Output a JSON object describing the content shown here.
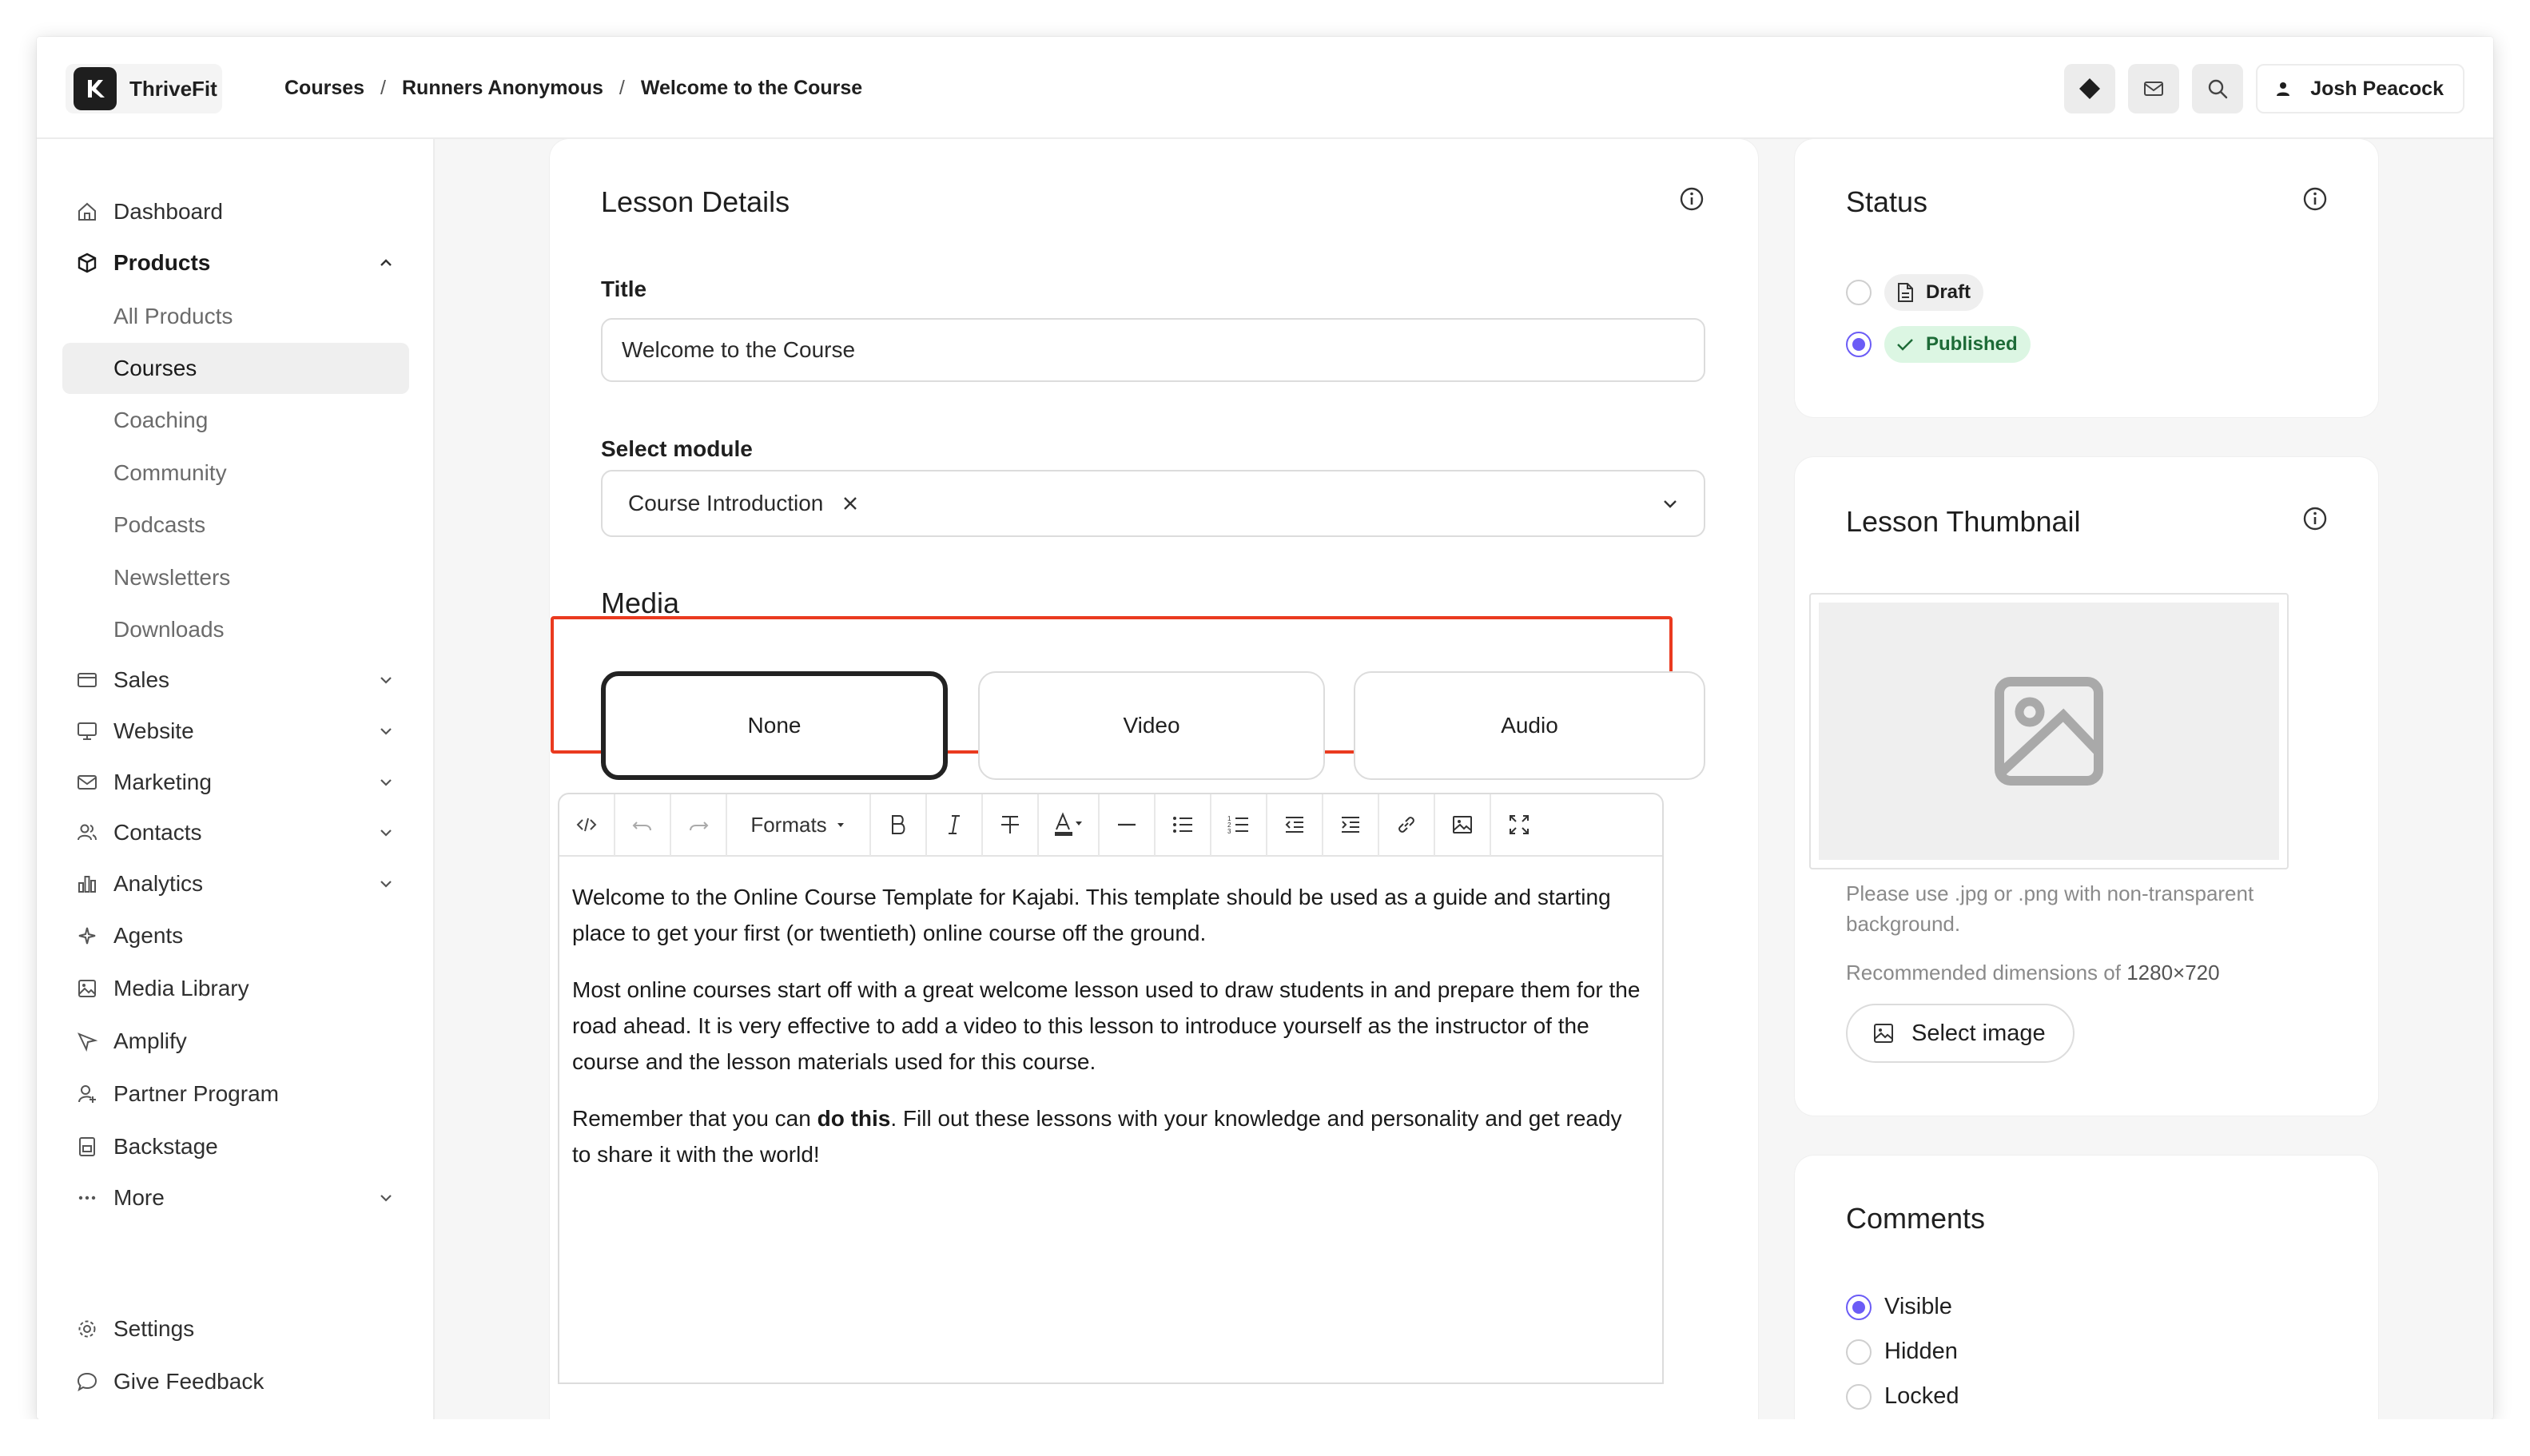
{
  "app": {
    "name": "ThriveFit"
  },
  "breadcrumb": [
    "Courses",
    "Runners Anonymous",
    "Welcome to the Course"
  ],
  "user": {
    "name": "Josh Peacock"
  },
  "sidebar": {
    "items": [
      {
        "label": "Dashboard",
        "icon": "home-icon"
      },
      {
        "label": "Products",
        "icon": "box-icon"
      },
      {
        "label": "Sales",
        "icon": "credit-card-icon"
      },
      {
        "label": "Website",
        "icon": "monitor-icon"
      },
      {
        "label": "Marketing",
        "icon": "mail-icon"
      },
      {
        "label": "Contacts",
        "icon": "users-icon"
      },
      {
        "label": "Analytics",
        "icon": "bar-chart-icon"
      },
      {
        "label": "Agents",
        "icon": "sparkle-icon"
      },
      {
        "label": "Media Library",
        "icon": "image-icon"
      },
      {
        "label": "Amplify",
        "icon": "send-icon"
      },
      {
        "label": "Partner Program",
        "icon": "partner-icon"
      },
      {
        "label": "Backstage",
        "icon": "backstage-icon"
      },
      {
        "label": "More",
        "icon": "more-icon"
      }
    ],
    "products_sub": [
      "All Products",
      "Courses",
      "Coaching",
      "Community",
      "Podcasts",
      "Newsletters",
      "Downloads"
    ],
    "footer": [
      {
        "label": "Settings",
        "icon": "gear-icon"
      },
      {
        "label": "Give Feedback",
        "icon": "chat-icon"
      }
    ]
  },
  "lesson": {
    "heading": "Lesson Details",
    "title_label": "Title",
    "title_value": "Welcome to the Course",
    "module_label": "Select module",
    "module_value": "Course Introduction",
    "media_heading": "Media",
    "media_options": [
      "None",
      "Video",
      "Audio"
    ],
    "selected_media": "None"
  },
  "editor": {
    "formats_label": "Formats",
    "p1": "Welcome to the Online Course Template for Kajabi. This template should be used as a guide and starting place to get your first (or twentieth) online course off the ground.",
    "p2": "Most online courses start off with a great welcome lesson used to draw students in and prepare them for the road ahead. It is very effective to add a video to this lesson to introduce yourself as the instructor of the course and the lesson materials used for this course.",
    "p3_pre": "Remember that you can ",
    "p3_bold": "do this",
    "p3_post": ". Fill out these lessons with your knowledge and personality and get ready to share it with the world!"
  },
  "status": {
    "heading": "Status",
    "draft_label": "Draft",
    "published_label": "Published",
    "selected": "Published"
  },
  "thumbnail": {
    "heading": "Lesson Thumbnail",
    "hint": "Please use .jpg or .png with non-transparent background.",
    "dimensions_prefix": "Recommended dimensions of ",
    "dimensions_value": "1280×720",
    "button": "Select image"
  },
  "comments": {
    "heading": "Comments",
    "options": [
      "Visible",
      "Hidden",
      "Locked"
    ],
    "selected": "Visible"
  },
  "colors": {
    "accent": "#6b5cf6",
    "highlight": "#ea3a1f",
    "published_bg": "#dcf6e3",
    "published_text": "#1d7a3c"
  }
}
